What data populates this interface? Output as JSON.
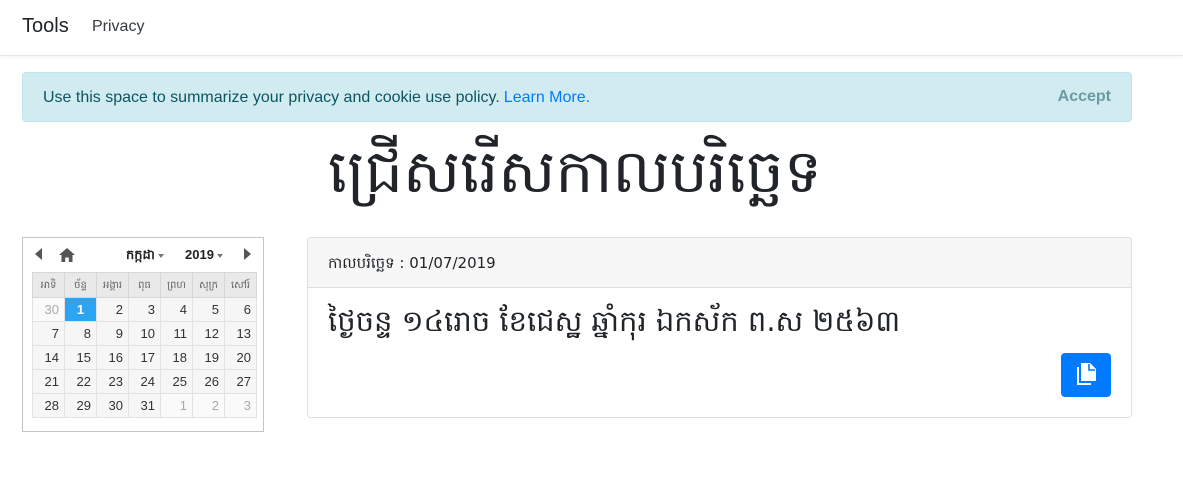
{
  "navbar": {
    "brand": "Tools",
    "links": [
      "Privacy"
    ]
  },
  "cookie": {
    "text": "Use this space to summarize your privacy and cookie use policy.",
    "link": "Learn More.",
    "accept": "Accept"
  },
  "title": "ជ្រើសរើសកាលបរិច្ឆេទ",
  "calendar": {
    "month": "កក្កដា",
    "year": "2019",
    "weekdays": [
      "អាទិ",
      "ច័ន្ទ",
      "អង្គារ",
      "ពុធ",
      "ព្រហ",
      "សុក្រ",
      "សៅរ៍"
    ],
    "weeks": [
      [
        "30",
        "1",
        "2",
        "3",
        "4",
        "5",
        "6"
      ],
      [
        "7",
        "8",
        "9",
        "10",
        "11",
        "12",
        "13"
      ],
      [
        "14",
        "15",
        "16",
        "17",
        "18",
        "19",
        "20"
      ],
      [
        "21",
        "22",
        "23",
        "24",
        "25",
        "26",
        "27"
      ],
      [
        "28",
        "29",
        "30",
        "31",
        "1",
        "2",
        "3"
      ]
    ],
    "selected_day": "1",
    "icons": [
      "chevron-left-icon",
      "home-icon",
      "chevron-right-icon"
    ]
  },
  "result": {
    "header_label": "កាលបរិច្ឆេទ",
    "header_value": "01/07/2019",
    "lunar_text": "ថ្ងៃចន្ទ ១៤រោច ខែជេស្ឋ ឆ្នាំកុរ ឯកស័ក ព.ស ២៥៦៣",
    "copy_icon": "copy-icon"
  },
  "colors": {
    "accent": "#007bff",
    "selected": "#2da4f2",
    "alert_bg": "#d1ecf1"
  }
}
